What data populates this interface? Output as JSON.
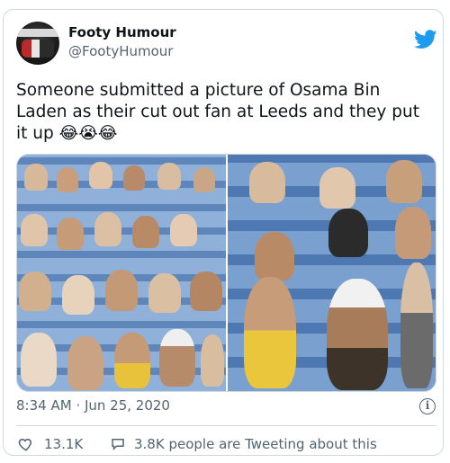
{
  "author": {
    "name": "Footy Humour",
    "handle": "@FootyHumour",
    "avatar_text": "FOOTY HUMOUR"
  },
  "tweet": {
    "text": "Someone submitted a picture of Osama Bin Laden as their cut out fan at Leeds and they put it up 😂😭😂",
    "timestamp": "8:34 AM · Jun 25, 2020"
  },
  "engagement": {
    "likes": "13.1K",
    "tweeting": "3.8K people are Tweeting about this"
  },
  "colors": {
    "brand": "#1d9bf0",
    "text": "#0f1419",
    "muted": "#536471",
    "border": "#cfd9de"
  },
  "icons": {
    "logo": "twitter-bird-icon",
    "info": "info-icon",
    "like": "heart-icon",
    "reply": "speech-bubble-icon"
  }
}
